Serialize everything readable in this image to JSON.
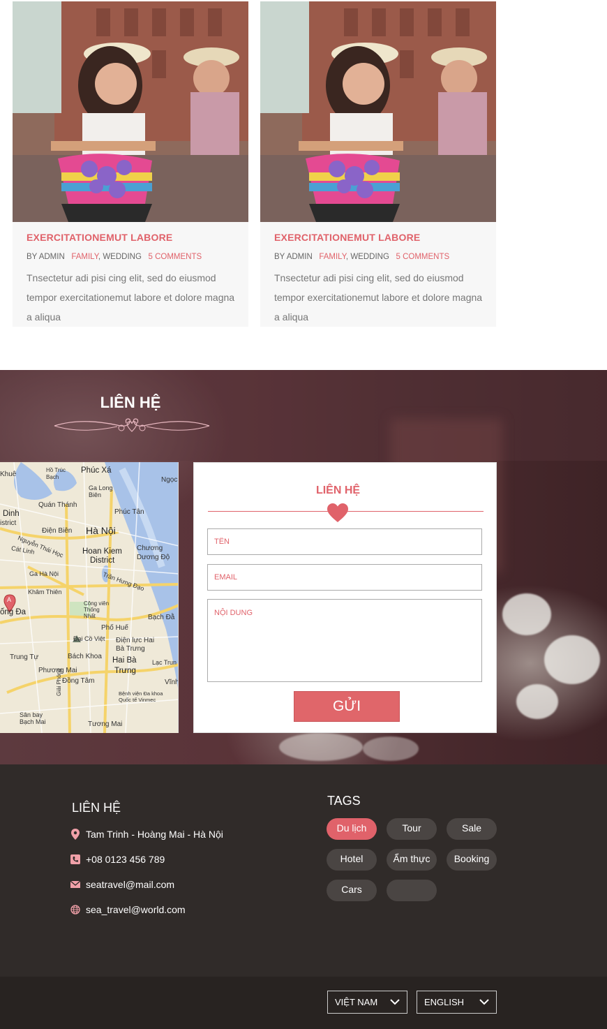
{
  "posts": [
    {
      "title": "EXERCITATIONEMUT LABORE",
      "by": "BY ADMIN",
      "category_1": "FAMILY",
      "category_2": "WEDDING",
      "comments": "5 COMMENTS",
      "excerpt": "Tnsectetur adi pisi cing elit, sed do eiusmod tempor exercitationemut labore et dolore magna a aliqua"
    },
    {
      "title": "EXERCITATIONEMUT LABORE",
      "by": "BY ADMIN",
      "category_1": "FAMILY",
      "category_2": "WEDDING",
      "comments": "5 COMMENTS",
      "excerpt": "Tnsectetur adi pisi cing elit, sed do eiusmod tempor exercitationemut labore et dolore magna a aliqua"
    }
  ],
  "contact_section": {
    "title": "LIÊN HỆ",
    "map_labels": [
      "Khuê",
      "Phúc Xá",
      "Hồ Trúc Bạch",
      "Ngọc",
      "Ga Long Biên",
      "Quán Thánh",
      "Phúc Tân",
      "Dinh",
      "istrict",
      "Điện Biên",
      "Hà Nội",
      "Nguyễn Thái Học",
      "Cát Linh",
      "Hoan Kiem",
      "District",
      "Chương Dương Độ",
      "Ga Hà Nội",
      "Trần Hưng Đạo",
      "Khâm Thiên",
      "A",
      "ống Đa",
      "Công viên Thống Nhất",
      "Bạch Đằ",
      "Phố Huế",
      "Đại Cồ Việt",
      "Điện lực Hai Bà Trưng",
      "Trung Tự",
      "Bách Khoa",
      "Hai Bà",
      "Trưng",
      "Lạc Trun",
      "Phương Mai",
      "Đồng Tâm",
      "Vĩnh",
      "Bệnh viện Đa khoa Quốc tế Vinmec",
      "Sân bay Bạch Mai",
      "Tương Mai",
      "Giải Phóng"
    ],
    "form": {
      "title": "LIÊN HỆ",
      "name_placeholder": "TÊN",
      "email_placeholder": "EMAIL",
      "message_placeholder": "NỘI DUNG",
      "send_label": "GỬI"
    }
  },
  "footer": {
    "contact_title": "LIÊN HỆ",
    "address": "Tam Trinh - Hoàng Mai - Hà Nội",
    "phone": "+08 0123 456 789",
    "email": "seatravel@mail.com",
    "website": "sea_travel@world.com",
    "tags_title": "TAGS",
    "tags": [
      "Du lịch",
      "Tour",
      "Sale",
      "Hotel",
      "Ẩm thực",
      "Booking",
      "Cars",
      ""
    ]
  },
  "languages": {
    "vietnamese": "VIỆT NAM",
    "english": "ENGLISH"
  },
  "colors": {
    "accent": "#e0626a",
    "footer_bg": "#302b29",
    "bottom_bar_bg": "#282321"
  }
}
